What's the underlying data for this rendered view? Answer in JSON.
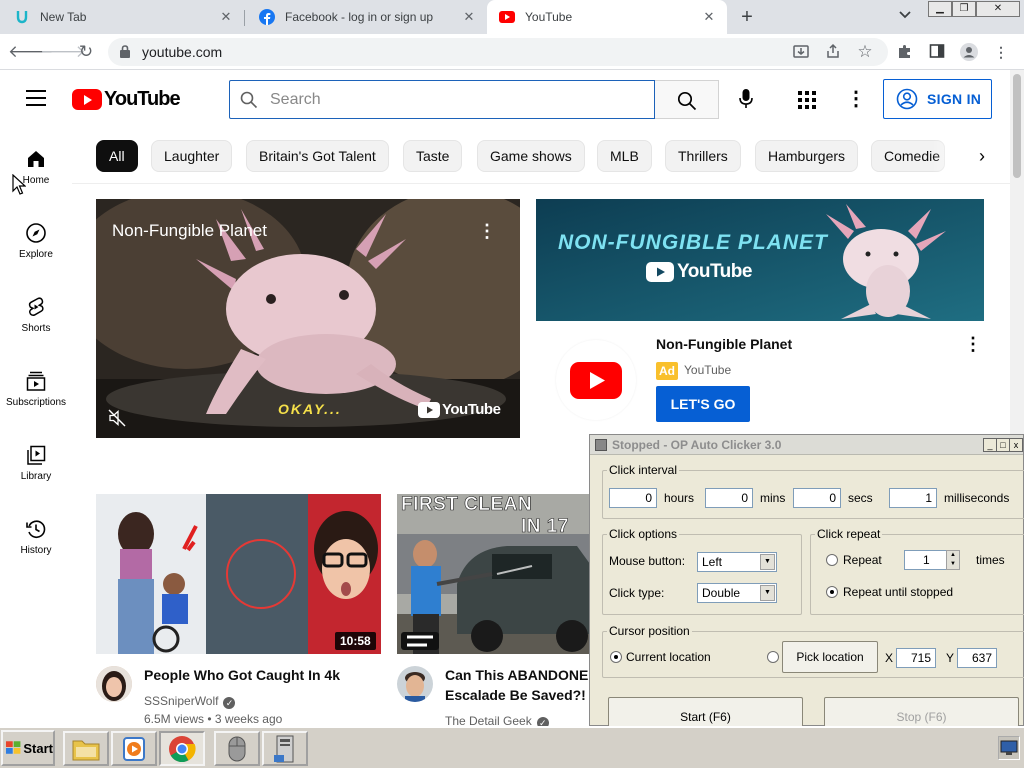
{
  "browser": {
    "tabs": [
      {
        "title": "New Tab",
        "active": false
      },
      {
        "title": "Facebook - log in or sign up",
        "active": false
      },
      {
        "title": "YouTube",
        "active": true
      }
    ],
    "url": "youtube.com"
  },
  "youtube": {
    "logo_text": "YouTube",
    "search": {
      "placeholder": "Search",
      "value": ""
    },
    "signin_label": "SIGN IN",
    "chips": [
      "All",
      "Laughter",
      "Britain's Got Talent",
      "Taste",
      "Game shows",
      "MLB",
      "Thrillers",
      "Hamburgers",
      "Comedie"
    ],
    "guide": [
      {
        "label": "Home",
        "icon": "home-icon"
      },
      {
        "label": "Explore",
        "icon": "compass-icon"
      },
      {
        "label": "Shorts",
        "icon": "shorts-icon"
      },
      {
        "label": "Subscriptions",
        "icon": "subscriptions-icon"
      },
      {
        "label": "Library",
        "icon": "library-icon"
      },
      {
        "label": "History",
        "icon": "history-icon"
      }
    ],
    "ad": {
      "video_title": "Non-Fungible Planet",
      "video_caption": "OKAY...",
      "watermark": "YouTube",
      "banner_title": "NON-FUNGIBLE PLANET",
      "banner_brand": "YouTube",
      "title": "Non-Fungible Planet",
      "badge": "Ad",
      "advertiser": "YouTube",
      "cta": "LET'S GO"
    },
    "videos": [
      {
        "title": "People Who Got Caught In 4k",
        "channel": "SSSniperWolf",
        "views": "6.5M views",
        "age": "3 weeks ago",
        "duration": "10:58"
      },
      {
        "title_line1": "Can This ABANDONED",
        "title_line2": "Escalade Be Saved?! | T",
        "channel": "The Detail Geek",
        "overlay_line1": "FIRST CLEAN",
        "overlay_line2": "IN 17"
      }
    ]
  },
  "autoclicker": {
    "title": "Stopped - OP Auto Clicker 3.0",
    "click_interval": {
      "legend": "Click interval",
      "hours": "0",
      "hours_label": "hours",
      "mins": "0",
      "mins_label": "mins",
      "secs": "0",
      "secs_label": "secs",
      "ms": "1",
      "ms_label": "milliseconds"
    },
    "click_options": {
      "legend": "Click options",
      "mouse_button_label": "Mouse button:",
      "mouse_button": "Left",
      "click_type_label": "Click type:",
      "click_type": "Double"
    },
    "click_repeat": {
      "legend": "Click repeat",
      "repeat_label": "Repeat",
      "repeat_count": "1",
      "times_label": "times",
      "until_stopped_label": "Repeat until stopped"
    },
    "cursor_position": {
      "legend": "Cursor position",
      "current_label": "Current location",
      "pick_label": "Pick location",
      "x_label": "X",
      "x": "715",
      "y_label": "Y",
      "y": "637"
    },
    "start_label": "Start (F6)",
    "stop_label": "Stop (F6)"
  },
  "taskbar": {
    "start_label": "Start"
  },
  "colors": {
    "yt_red": "#ff0000",
    "yt_blue": "#065fd4",
    "ad_yellow": "#f9c02c"
  }
}
